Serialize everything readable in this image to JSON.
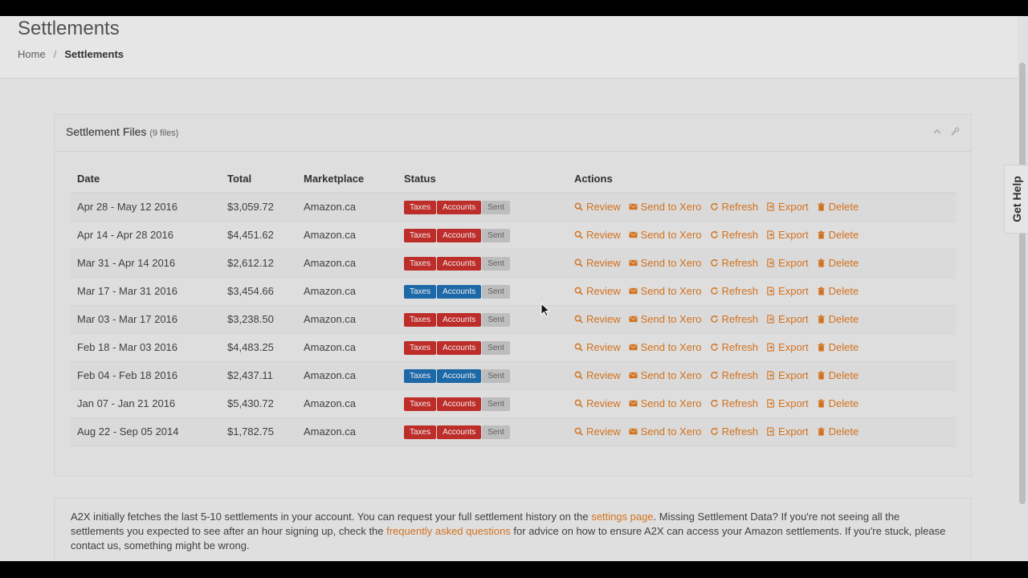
{
  "header": {
    "title": "Settlements",
    "breadcrumb": {
      "home": "Home",
      "separator": "/",
      "current": "Settlements"
    }
  },
  "panel": {
    "title": "Settlement Files",
    "count": "(9 files)",
    "tools": {
      "collapse_icon": "chevron-up-icon",
      "config_icon": "wrench-icon"
    }
  },
  "table": {
    "headers": {
      "date": "Date",
      "total": "Total",
      "marketplace": "Marketplace",
      "status": "Status",
      "actions": "Actions"
    },
    "status_labels": {
      "taxes": "Taxes",
      "accounts": "Accounts",
      "sent": "Sent"
    },
    "action_labels": {
      "review": "Review",
      "send": "Send to Xero",
      "refresh": "Refresh",
      "export": "Export",
      "delete": "Delete"
    },
    "rows": [
      {
        "date": "Apr 28 - May 12 2016",
        "total": "$3,059.72",
        "marketplace": "Amazon.ca",
        "taxes_color": "#c9302c",
        "accounts_color": "#c9302c"
      },
      {
        "date": "Apr 14 - Apr 28 2016",
        "total": "$4,451.62",
        "marketplace": "Amazon.ca",
        "taxes_color": "#c9302c",
        "accounts_color": "#c9302c"
      },
      {
        "date": "Mar 31 - Apr 14 2016",
        "total": "$2,612.12",
        "marketplace": "Amazon.ca",
        "taxes_color": "#c9302c",
        "accounts_color": "#c9302c"
      },
      {
        "date": "Mar 17 - Mar 31 2016",
        "total": "$3,454.66",
        "marketplace": "Amazon.ca",
        "taxes_color": "#1f6fb2",
        "accounts_color": "#1f6fb2"
      },
      {
        "date": "Mar 03 - Mar 17 2016",
        "total": "$3,238.50",
        "marketplace": "Amazon.ca",
        "taxes_color": "#c9302c",
        "accounts_color": "#c9302c"
      },
      {
        "date": "Feb 18 - Mar 03 2016",
        "total": "$4,483.25",
        "marketplace": "Amazon.ca",
        "taxes_color": "#c9302c",
        "accounts_color": "#c9302c"
      },
      {
        "date": "Feb 04 - Feb 18 2016",
        "total": "$2,437.11",
        "marketplace": "Amazon.ca",
        "taxes_color": "#1f6fb2",
        "accounts_color": "#1f6fb2"
      },
      {
        "date": "Jan 07 - Jan 21 2016",
        "total": "$5,430.72",
        "marketplace": "Amazon.ca",
        "taxes_color": "#c9302c",
        "accounts_color": "#c9302c"
      },
      {
        "date": "Aug 22 - Sep 05 2014",
        "total": "$1,782.75",
        "marketplace": "Amazon.ca",
        "taxes_color": "#c9302c",
        "accounts_color": "#c9302c"
      }
    ]
  },
  "help_tab": {
    "label": "Get Help"
  },
  "notice": {
    "text1": "A2X initially fetches the last 5-10 settlements in your account. You can request your full settlement history on the ",
    "link1": "settings page",
    "text2": ". Missing Settlement Data? If you're not seeing all the settlements you expected to see after an hour signing up, check the ",
    "link2": "frequently asked questions",
    "text3": " for advice on how to ensure A2X can access your Amazon settlements. If you're stuck, please contact us, something might be wrong."
  },
  "colors": {
    "accent": "#e07a20",
    "danger": "#c9302c",
    "primary": "#1f6fb2",
    "muted": "#c9c9c9"
  }
}
